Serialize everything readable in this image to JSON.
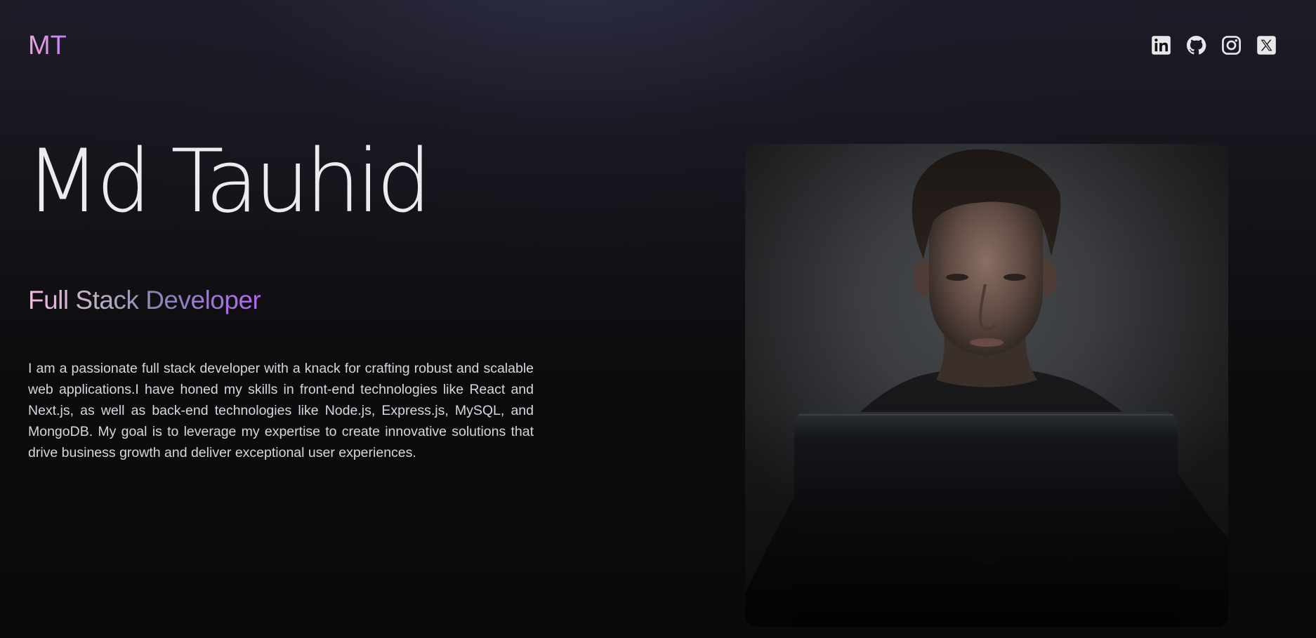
{
  "header": {
    "logo": "MT",
    "socials": [
      {
        "name": "LinkedIn",
        "icon": "linkedin-icon"
      },
      {
        "name": "GitHub",
        "icon": "github-icon"
      },
      {
        "name": "Instagram",
        "icon": "instagram-icon"
      },
      {
        "name": "X",
        "icon": "x-icon"
      }
    ]
  },
  "hero": {
    "name": "Md Tauhid",
    "role": "Full Stack Developer",
    "bio": "I am a passionate full stack developer with a knack for crafting robust and scalable web applications.I have honed my skills in front-end technologies like React and Next.js, as well as back-end technologies like Node.js, Express.js, MySQL, and MongoDB. My goal is to leverage my expertise to create innovative solutions that drive business growth and deliver exceptional user experiences."
  },
  "colors": {
    "background": "#0a0a0b",
    "accent_pink": "#f0a6d8",
    "accent_purple": "#b06aee",
    "text": "#d7d7db"
  }
}
